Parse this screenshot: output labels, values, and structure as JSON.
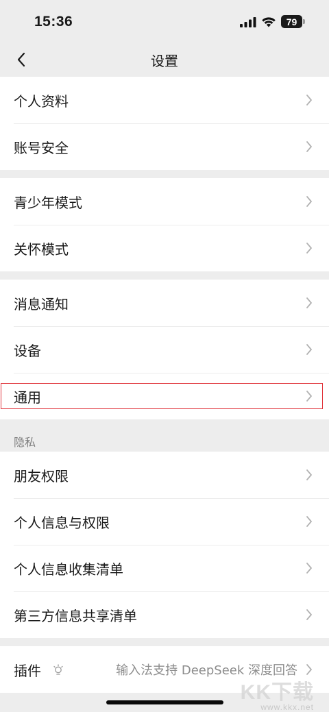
{
  "status_bar": {
    "time": "15:36",
    "battery": "79"
  },
  "header": {
    "title": "设置"
  },
  "groups": [
    {
      "items": [
        {
          "label": "个人资料"
        },
        {
          "label": "账号安全"
        }
      ]
    },
    {
      "items": [
        {
          "label": "青少年模式"
        },
        {
          "label": "关怀模式"
        }
      ]
    },
    {
      "items": [
        {
          "label": "消息通知"
        },
        {
          "label": "设备"
        },
        {
          "label": "通用"
        }
      ]
    },
    {
      "header": "隐私",
      "items": [
        {
          "label": "朋友权限"
        },
        {
          "label": "个人信息与权限"
        },
        {
          "label": "个人信息收集清单"
        },
        {
          "label": "第三方信息共享清单"
        }
      ]
    },
    {
      "items": [
        {
          "label": "插件",
          "detail": "输入法支持 DeepSeek 深度回答"
        }
      ]
    }
  ],
  "watermark": {
    "logo": "KK下载",
    "url": "www.kkx.net"
  },
  "colors": {
    "background": "#ededed",
    "card": "#ffffff",
    "highlight_border": "#e0333a"
  }
}
